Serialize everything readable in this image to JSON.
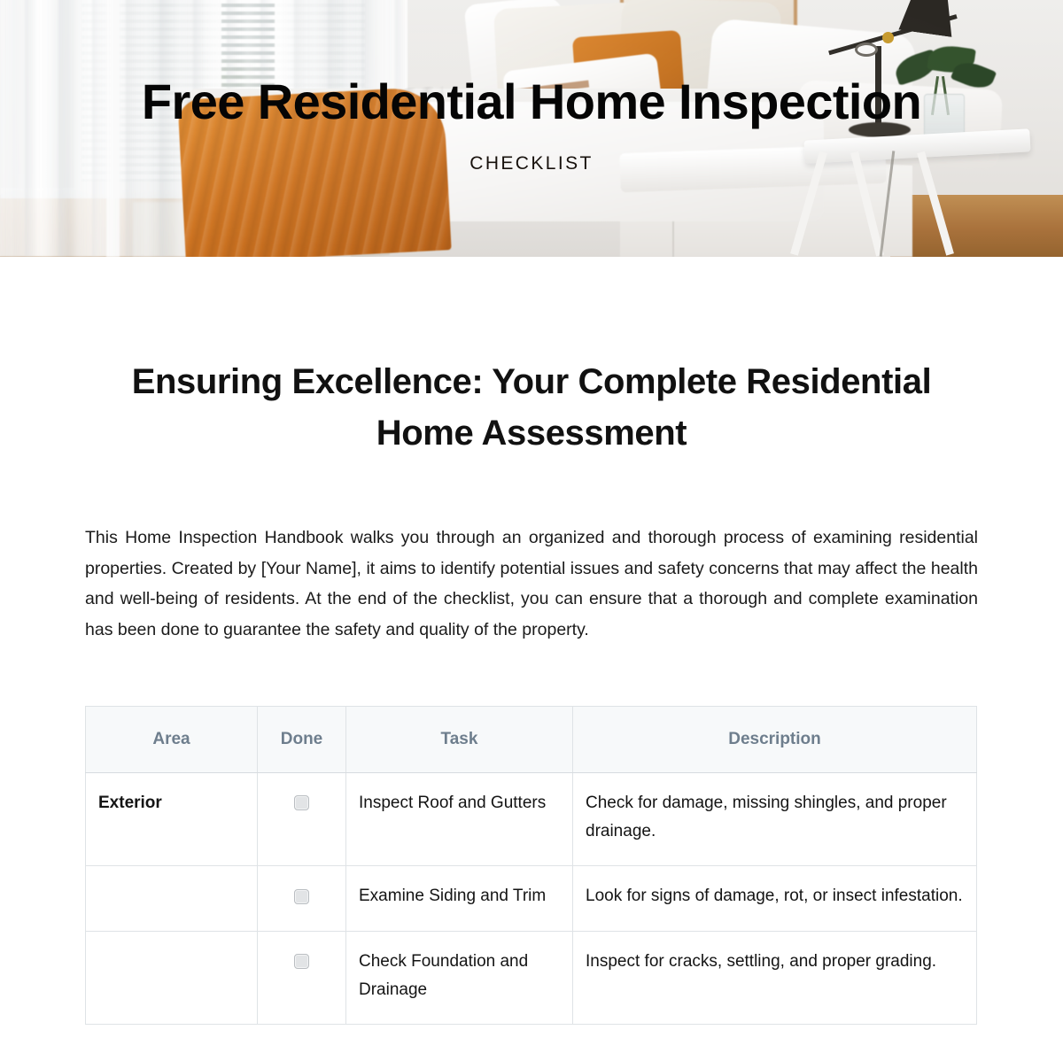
{
  "hero": {
    "title": "Free Residential Home Inspection",
    "subtitle": "CHECKLIST",
    "scene_description": "Bedroom with white bedding, orange accent pillow and throw, white side table with black lamp and glass vase",
    "title_color": "#050505"
  },
  "document": {
    "heading": "Ensuring Excellence: Your Complete Residential Home Assessment",
    "intro": "This Home Inspection Handbook walks you through an organized and thorough process of examining residential properties. Created by [Your Name], it aims to identify potential issues and safety concerns that may affect the health and well-being of residents. At the end of the checklist, you can ensure that a thorough and complete examination has been done to guarantee the safety and quality of the property."
  },
  "table": {
    "header_color": "#6e7e8d",
    "header_bg": "#f7f9fa",
    "columns": [
      {
        "key": "area",
        "label": "Area"
      },
      {
        "key": "done",
        "label": "Done"
      },
      {
        "key": "task",
        "label": "Task"
      },
      {
        "key": "description",
        "label": "Description"
      }
    ],
    "rows": [
      {
        "area": "Exterior",
        "done": false,
        "task": "Inspect Roof and Gutters",
        "description": "Check for damage, missing shingles, and proper drainage."
      },
      {
        "area": "",
        "done": false,
        "task": "Examine Siding and Trim",
        "description": "Look for signs of damage, rot, or insect infestation."
      },
      {
        "area": "",
        "done": false,
        "task": "Check Foundation and Drainage",
        "description": "Inspect for cracks, settling, and proper grading."
      }
    ]
  }
}
